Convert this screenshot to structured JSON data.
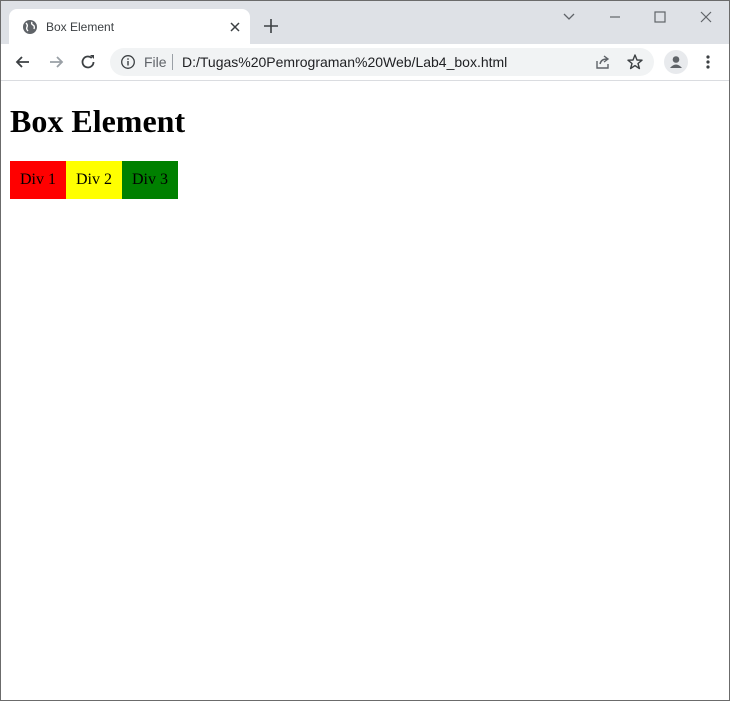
{
  "window": {
    "controls": [
      "chevron-down-icon",
      "minimize-icon",
      "maximize-icon",
      "close-icon"
    ]
  },
  "tab": {
    "title": "Box Element",
    "favicon": "globe-icon"
  },
  "toolbar": {
    "buttons": [
      "back-icon",
      "forward-icon",
      "reload-icon"
    ]
  },
  "address_bar": {
    "scheme_label": "File",
    "url": "D:/Tugas%20Pemrograman%20Web/Lab4_box.html"
  },
  "page": {
    "heading": "Box Element",
    "boxes": [
      {
        "label": "Div 1",
        "color": "#ff0000"
      },
      {
        "label": "Div 2",
        "color": "#ffff00"
      },
      {
        "label": "Div 3",
        "color": "#008000"
      }
    ]
  }
}
